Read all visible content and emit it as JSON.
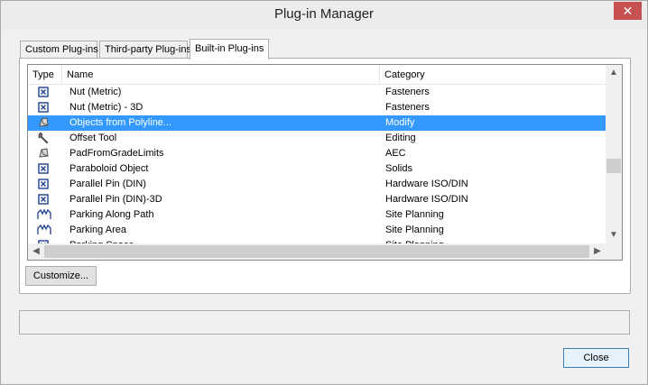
{
  "window": {
    "title": "Plug-in Manager",
    "close_glyph": "✕"
  },
  "tabs": [
    {
      "label": "Custom Plug-ins"
    },
    {
      "label": "Third-party Plug-ins"
    },
    {
      "label": "Built-in Plug-ins",
      "active": true
    }
  ],
  "list": {
    "columns": [
      "Type",
      "Name",
      "Category"
    ],
    "rows": [
      {
        "icon": "box-x-icon",
        "name": "Nut (Metric)",
        "category": "Fasteners"
      },
      {
        "icon": "box-x-icon",
        "name": "Nut (Metric) - 3D",
        "category": "Fasteners"
      },
      {
        "icon": "polyline-object-icon",
        "name": "Objects from Polyline...",
        "category": "Modify",
        "selected": true
      },
      {
        "icon": "wrench-icon",
        "name": "Offset Tool",
        "category": "Editing"
      },
      {
        "icon": "polyline-object-icon",
        "name": "PadFromGradeLimits",
        "category": "AEC"
      },
      {
        "icon": "box-x-icon",
        "name": "Paraboloid Object",
        "category": "Solids"
      },
      {
        "icon": "box-x-icon",
        "name": "Parallel Pin (DIN)",
        "category": "Hardware ISO/DIN"
      },
      {
        "icon": "box-x-icon",
        "name": "Parallel Pin (DIN)-3D",
        "category": "Hardware ISO/DIN"
      },
      {
        "icon": "parking-icon",
        "name": "Parking Along Path",
        "category": "Site Planning"
      },
      {
        "icon": "parking-icon",
        "name": "Parking Area",
        "category": "Site Planning"
      },
      {
        "icon": "box-x-icon",
        "name": "Parking Space",
        "category": "Site Planning"
      }
    ]
  },
  "buttons": {
    "customize": "Customize...",
    "close": "Close"
  },
  "scroll": {
    "up": "▲",
    "down": "▼",
    "left": "◀",
    "right": "▶"
  },
  "colors": {
    "selection": "#3399ff",
    "close_button": "#c75050"
  }
}
